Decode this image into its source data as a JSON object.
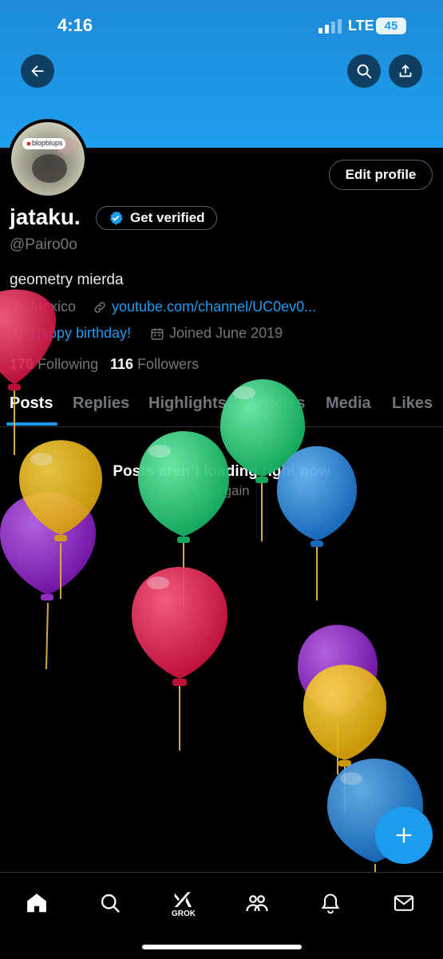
{
  "status_bar": {
    "time": "4:16",
    "network": "LTE",
    "battery": "45"
  },
  "header": {
    "back_icon": "arrow-left-icon",
    "search_icon": "search-icon",
    "share_icon": "share-icon"
  },
  "profile": {
    "avatar_sticker_text": "blopblups",
    "edit_profile_label": "Edit profile",
    "name": "jataku.",
    "get_verified_label": "Get verified",
    "handle": "@Pairo0o",
    "bio": "geometry mierda",
    "location": "Mexico",
    "website": "youtube.com/channel/UC0ev0...",
    "birthday": "Happy birthday!",
    "joined": "Joined June 2019",
    "following_count": "170",
    "following_label": "Following",
    "followers_count": "116",
    "followers_label": "Followers"
  },
  "tabs": [
    "Posts",
    "Replies",
    "Highlights",
    "Articles",
    "Media",
    "Likes"
  ],
  "active_tab": "Posts",
  "feed": {
    "error_title": "Posts aren’t loading right now",
    "retry_label": "Try again"
  },
  "bottom_nav": {
    "items": [
      "home-icon",
      "search-icon",
      "grok-icon",
      "communities-icon",
      "notifications-icon",
      "messages-icon"
    ],
    "grok_label": "GROK"
  },
  "colors": {
    "accent": "#1d9bf0",
    "banner": "#1f9ff0",
    "background": "#000000",
    "secondary_text": "#71767b",
    "balloon_red": "#e0244f",
    "balloon_yellow": "#f2be1a",
    "balloon_purple": "#9b2fd0",
    "balloon_green": "#2fd67c",
    "balloon_blue": "#2e8fe0"
  }
}
